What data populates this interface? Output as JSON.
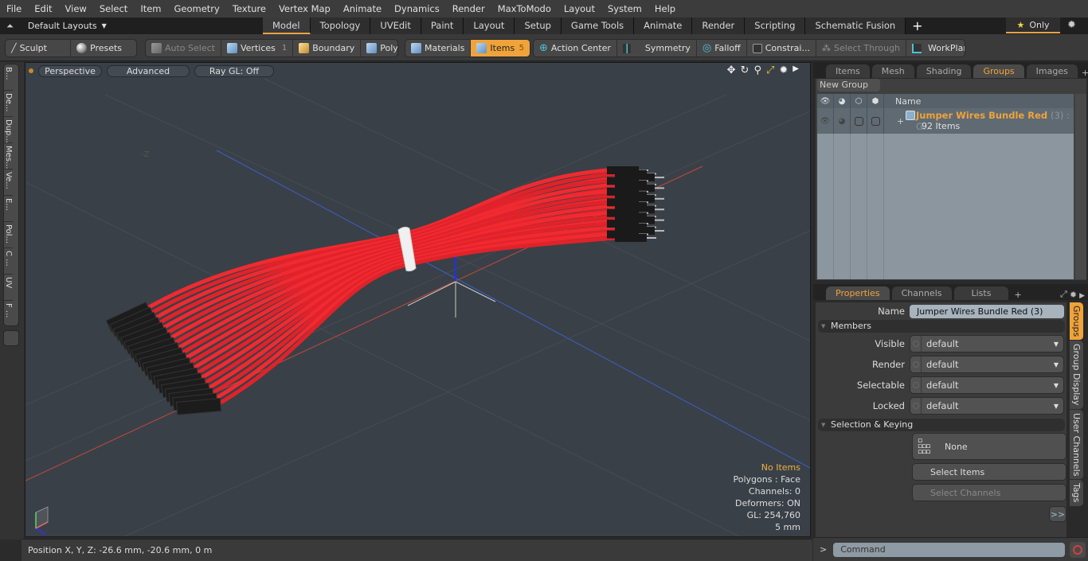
{
  "menu": [
    "File",
    "Edit",
    "View",
    "Select",
    "Item",
    "Geometry",
    "Texture",
    "Vertex Map",
    "Animate",
    "Dynamics",
    "Render",
    "MaxToModo",
    "Layout",
    "System",
    "Help"
  ],
  "layout_selector": {
    "label": "Default Layouts"
  },
  "layout_tabs": [
    {
      "label": "Model",
      "active": true
    },
    {
      "label": "Topology"
    },
    {
      "label": "UVEdit"
    },
    {
      "label": "Paint"
    },
    {
      "label": "Layout"
    },
    {
      "label": "Setup"
    },
    {
      "label": "Game Tools"
    },
    {
      "label": "Animate"
    },
    {
      "label": "Render"
    },
    {
      "label": "Scripting"
    },
    {
      "label": "Schematic Fusion"
    }
  ],
  "only_label": "Only",
  "toolbar": {
    "sculpt": "Sculpt",
    "presets": "Presets",
    "auto_select": "Auto Select",
    "vertices": "Vertices",
    "vertices_count": "1",
    "boundary": "Boundary",
    "polygons": "Polygons",
    "materials": "Materials",
    "items": "Items",
    "items_count": "5",
    "action_center": "Action Center",
    "symmetry": "Symmetry",
    "falloff": "Falloff",
    "constraints": "Constrai...",
    "select_through": "Select Through",
    "workplane": "WorkPlane"
  },
  "left_tabs": [
    "B...",
    "De...",
    "Dup...",
    "Mes...",
    "Ve...",
    "E...",
    "Pol...",
    "C ...",
    "UV",
    "F ..."
  ],
  "viewport": {
    "view_mode": "Perspective",
    "shading": "Advanced",
    "raygl": "Ray GL: Off",
    "axis_label": "-Z",
    "stats": {
      "selection": "No Items",
      "polygons": "Polygons : Face",
      "channels": "Channels: 0",
      "deformers": "Deformers: ON",
      "gl": "GL: 254,760",
      "grid": "5 mm"
    }
  },
  "status": {
    "position": "Position X, Y, Z:   -26.6 mm, -20.6 mm, 0 m"
  },
  "top_panel": {
    "tabs": [
      {
        "label": "Items"
      },
      {
        "label": "Mesh ..."
      },
      {
        "label": "Shading"
      },
      {
        "label": "Groups",
        "active": true
      },
      {
        "label": "Images"
      }
    ],
    "new_group": "New Group",
    "column_name": "Name",
    "group": {
      "name": "Jumper Wires Bundle Red",
      "suffix": "(3) : G...",
      "count": "92 Items"
    }
  },
  "bottom_panel": {
    "tabs": [
      {
        "label": "Properties",
        "active": true
      },
      {
        "label": "Channels"
      },
      {
        "label": "Lists"
      }
    ],
    "name_label": "Name",
    "name_value": "Jumper Wires Bundle Red (3)",
    "members_section": "Members",
    "members": [
      {
        "label": "Visible",
        "value": "default"
      },
      {
        "label": "Render",
        "value": "default"
      },
      {
        "label": "Selectable",
        "value": "default"
      },
      {
        "label": "Locked",
        "value": "default"
      }
    ],
    "keying_section": "Selection & Keying",
    "none_label": "None",
    "select_items": "Select Items",
    "select_channels": "Select Channels",
    "more": ">>",
    "side_tabs": [
      {
        "label": "Groups",
        "active": true
      },
      {
        "label": "Group Display"
      },
      {
        "label": "User Channels"
      },
      {
        "label": "Tags"
      }
    ]
  },
  "command": {
    "prompt": ">",
    "placeholder": "Command"
  }
}
